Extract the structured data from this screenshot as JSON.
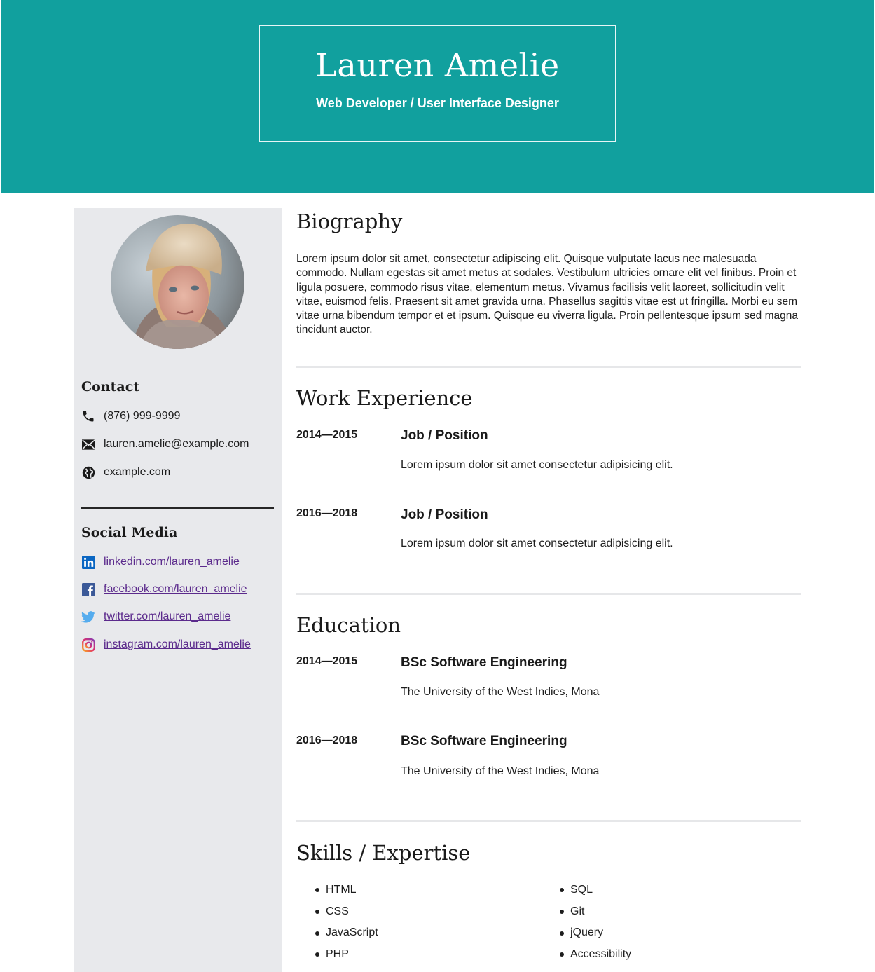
{
  "header": {
    "name": "Lauren Amelie",
    "title": "Web Developer / User Interface Designer",
    "background_color": "#11a09e"
  },
  "sidebar": {
    "contact_heading": "Contact",
    "contact": [
      {
        "icon": "phone-icon",
        "text": "(876) 999-9999"
      },
      {
        "icon": "envelope-icon",
        "text": "lauren.amelie@example.com"
      },
      {
        "icon": "globe-icon",
        "text": "example.com"
      }
    ],
    "social_heading": "Social Media",
    "social": [
      {
        "icon": "linkedin-icon",
        "text": "linkedin.com/lauren_amelie"
      },
      {
        "icon": "facebook-icon",
        "text": "facebook.com/lauren_amelie"
      },
      {
        "icon": "twitter-icon",
        "text": "twitter.com/lauren_amelie"
      },
      {
        "icon": "instagram-icon",
        "text": "instagram.com/lauren_amelie"
      }
    ],
    "link_color": "#5b2a8c"
  },
  "biography": {
    "heading": "Biography",
    "text": "Lorem ipsum dolor sit amet, consectetur adipiscing elit. Quisque vulputate lacus nec malesuada commodo. Nullam egestas sit amet metus at sodales. Vestibulum ultricies ornare elit vel finibus. Proin et ligula posuere, commodo risus vitae, elementum metus. Vivamus facilisis velit laoreet, sollicitudin velit vitae, euismod felis. Praesent sit amet gravida urna. Phasellus sagittis vitae est ut fringilla. Morbi eu sem vitae urna bibendum tempor et et ipsum. Quisque eu viverra ligula. Proin pellentesque ipsum sed magna tincidunt auctor."
  },
  "work": {
    "heading": "Work Experience",
    "entries": [
      {
        "dates": "2014—2015",
        "title": "Job / Position",
        "desc": "Lorem ipsum dolor sit amet consectetur adipisicing elit."
      },
      {
        "dates": "2016—2018",
        "title": "Job / Position",
        "desc": "Lorem ipsum dolor sit amet consectetur adipisicing elit."
      }
    ]
  },
  "education": {
    "heading": "Education",
    "entries": [
      {
        "dates": "2014—2015",
        "title": "BSc Software Engineering",
        "desc": "The University of the West Indies, Mona"
      },
      {
        "dates": "2016—2018",
        "title": "BSc Software Engineering",
        "desc": "The University of the West Indies, Mona"
      }
    ]
  },
  "skills": {
    "heading": "Skills / Expertise",
    "col1": [
      "HTML",
      "CSS",
      "JavaScript",
      "PHP"
    ],
    "col2": [
      "SQL",
      "Git",
      "jQuery",
      "Accessibility"
    ]
  }
}
